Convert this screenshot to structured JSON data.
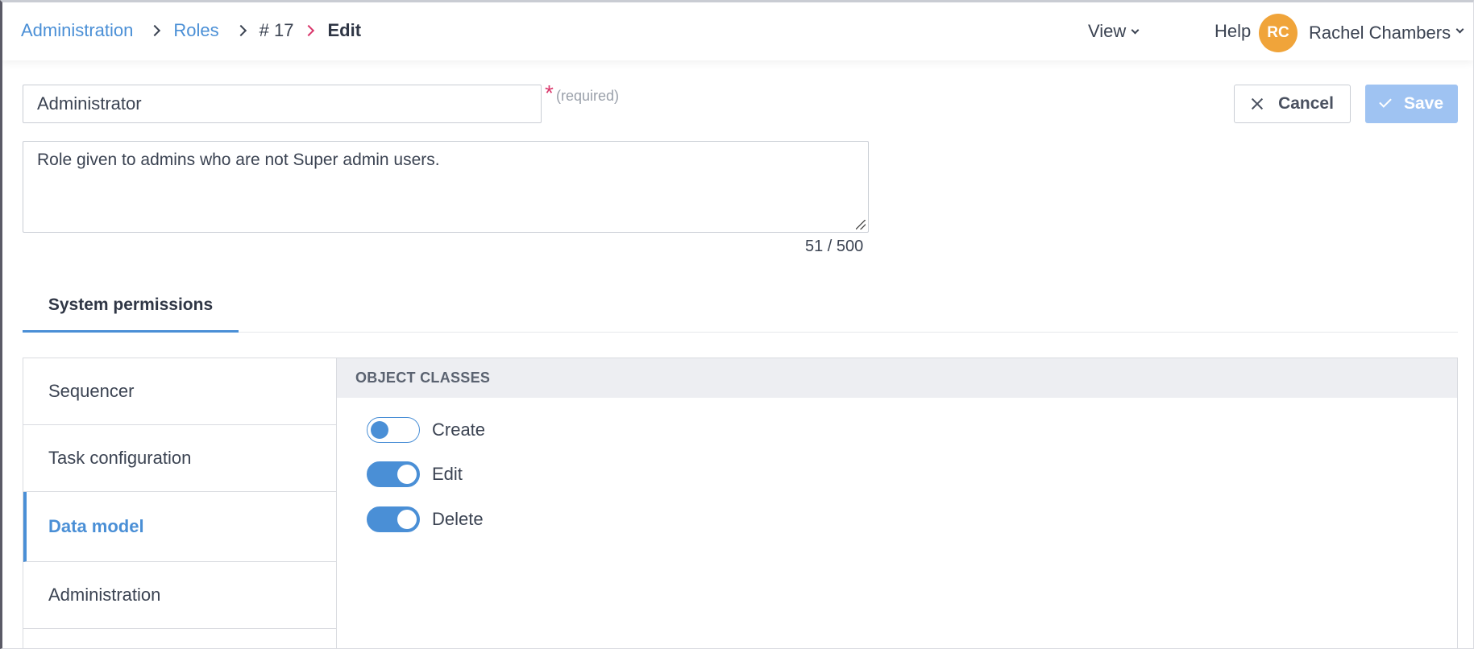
{
  "breadcrumb": {
    "items": [
      "Administration",
      "Roles"
    ],
    "id_text": "# 17",
    "current": "Edit"
  },
  "header": {
    "view_label": "View",
    "help_label": "Help",
    "user": {
      "initials": "RC",
      "name": "Rachel Chambers"
    }
  },
  "form": {
    "name_value": "Administrator",
    "required_marker": "*",
    "required_hint": "(required)",
    "description_value": "Role given to admins who are not Super admin users.",
    "char_count": "51 / 500"
  },
  "actions": {
    "cancel_label": "Cancel",
    "save_label": "Save"
  },
  "tabs": [
    {
      "label": "System permissions",
      "active": true
    }
  ],
  "permissions": {
    "categories": [
      {
        "label": "Sequencer",
        "active": false
      },
      {
        "label": "Task configuration",
        "active": false
      },
      {
        "label": "Data model",
        "active": true
      },
      {
        "label": "Administration",
        "active": false
      }
    ],
    "section_title": "OBJECT CLASSES",
    "toggles": [
      {
        "label": "Create",
        "enabled": false
      },
      {
        "label": "Edit",
        "enabled": true
      },
      {
        "label": "Delete",
        "enabled": true
      }
    ]
  },
  "colors": {
    "accent": "#4a8fd6",
    "avatar": "#f0a43a",
    "required": "#d9376b",
    "save_disabled": "#9fc3f2"
  }
}
